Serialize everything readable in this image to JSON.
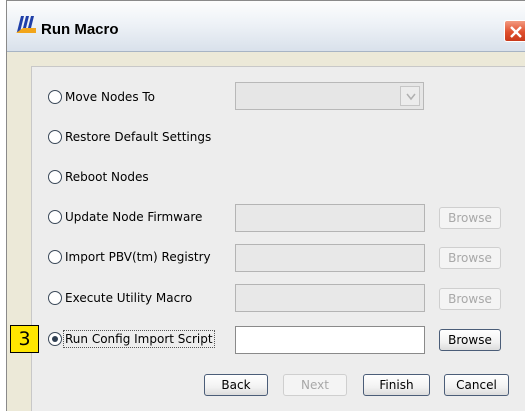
{
  "window": {
    "title": "Run Macro",
    "close_label": "Close"
  },
  "options": [
    {
      "label": "Move Nodes To",
      "checked": false
    },
    {
      "label": "Restore Default Settings",
      "checked": false
    },
    {
      "label": "Reboot Nodes",
      "checked": false
    },
    {
      "label": "Update Node Firmware",
      "checked": false
    },
    {
      "label": "Import PBV(tm) Registry",
      "checked": false
    },
    {
      "label": "Execute Utility Macro",
      "checked": false
    },
    {
      "label": "Run Config Import Script",
      "checked": true
    }
  ],
  "move_nodes_select": {
    "value": "",
    "enabled": false
  },
  "fields": {
    "firmware_path": "",
    "registry_path": "",
    "utility_macro_path": "",
    "config_script_path": ""
  },
  "browse_buttons": {
    "firmware": "Browse",
    "registry": "Browse",
    "utility_macro": "Browse",
    "config_script": "Browse"
  },
  "footer": {
    "back": "Back",
    "next": "Next",
    "finish": "Finish",
    "cancel": "Cancel"
  },
  "annotation": {
    "step_number": "3",
    "badge_color": "#ffe600"
  }
}
